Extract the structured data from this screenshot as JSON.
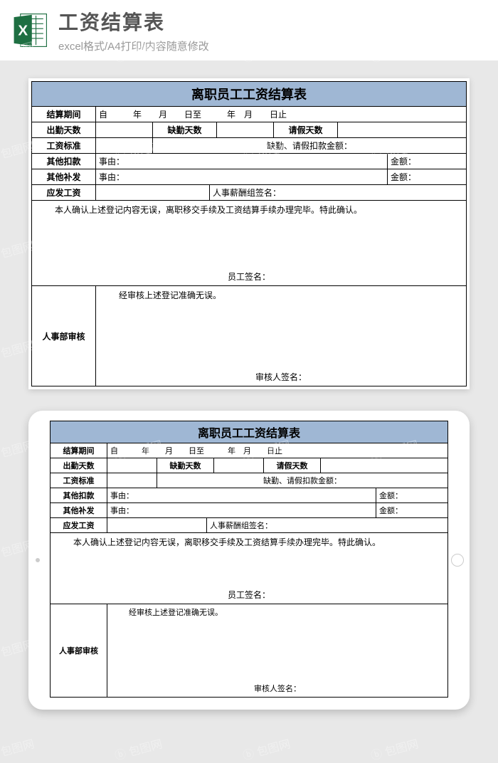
{
  "header": {
    "title": "工资结算表",
    "subtitle": "excel格式/A4打印/内容随意修改"
  },
  "form": {
    "title": "离职员工工资结算表",
    "row_period": {
      "label": "结算期间",
      "value": "自　　　年　　月　　日至　　　年　月　　日止"
    },
    "row_attendance": {
      "attend_label": "出勤天数",
      "absent_label": "缺勤天数",
      "leave_label": "请假天数"
    },
    "row_standard": {
      "label": "工资标准",
      "deduct_label": "缺勤、请假扣款金额："
    },
    "row_other_deduct": {
      "label": "其他扣款",
      "reason_label": "事由：",
      "amount_label": "金额："
    },
    "row_other_add": {
      "label": "其他补发",
      "reason_label": "事由：",
      "amount_label": "金额："
    },
    "row_payable": {
      "label": "应发工资",
      "hr_sign_label": "人事薪酬组签名："
    },
    "confirm": {
      "text": "本人确认上述登记内容无误，离职移交手续及工资结算手续办理完毕。特此确认。",
      "sign_label": "员工签名："
    },
    "audit": {
      "label": "人事部审核",
      "text": "经审核上述登记准确无误。",
      "sign_label": "审核人签名："
    }
  },
  "watermark": "包图网"
}
